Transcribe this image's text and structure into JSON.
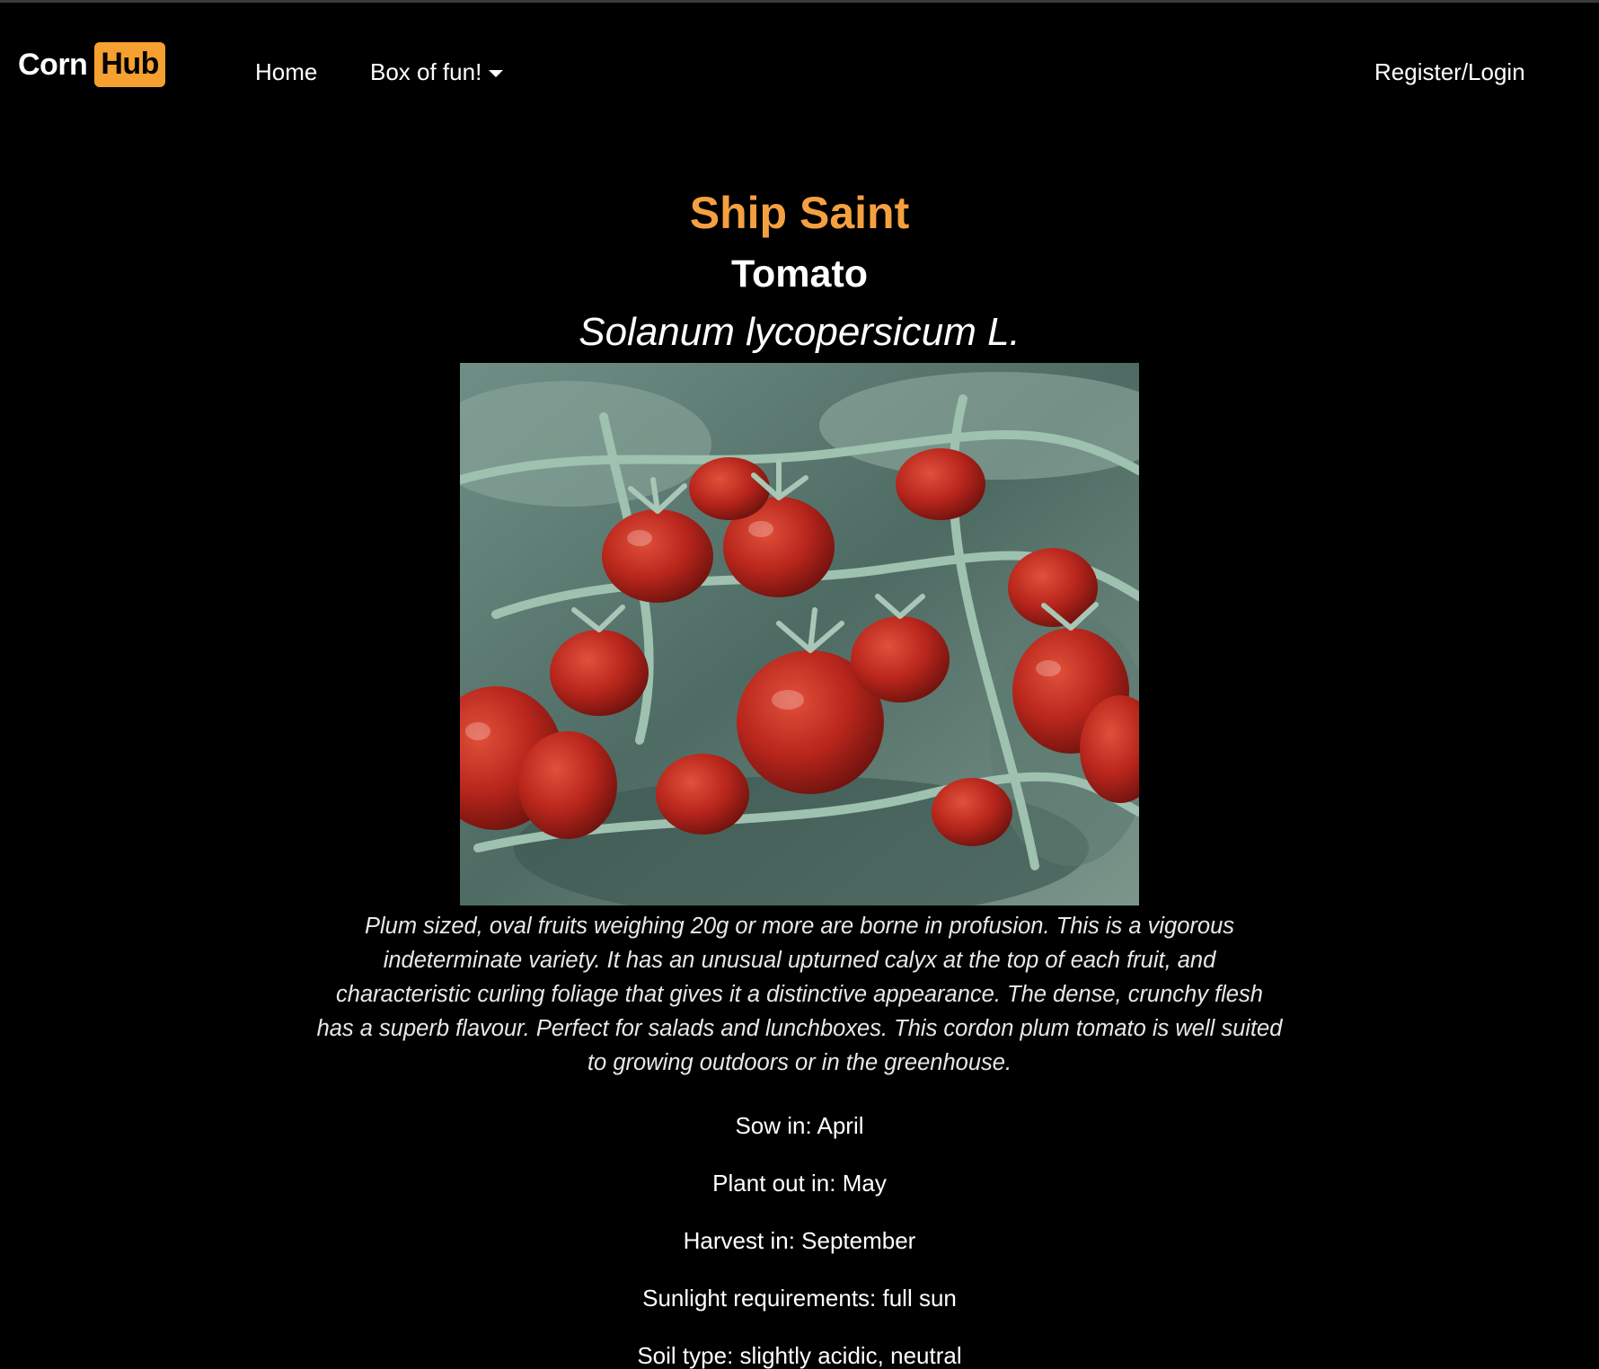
{
  "navbar": {
    "logo": {
      "part1": "Corn",
      "part2": "Hub"
    },
    "links": {
      "home": "Home",
      "box_of_fun": "Box of fun!",
      "register_login": "Register/Login"
    }
  },
  "colors": {
    "accent": "#f5a040",
    "background": "#000000",
    "text": "#ffffff"
  },
  "plant": {
    "variety": "Ship Saint",
    "crop": "Tomato",
    "latin_name": "Solanum lycopersicum L.",
    "image_subject": "clusters of red plum tomatoes on the vine",
    "description": "Plum sized, oval fruits weighing 20g or more are borne in profusion. This is a vigorous indeterminate variety. It has an unusual upturned calyx at the top of each fruit, and characteristic curling foliage that gives it a distinctive appearance. The dense, crunchy flesh has a superb flavour. Perfect for salads and lunchboxes. This cordon plum tomato is well suited to growing outdoors or in the greenhouse.",
    "facts": {
      "sow": "Sow in: April",
      "plant_out": "Plant out in: May",
      "harvest": "Harvest in: September",
      "sunlight": "Sunlight requirements: full sun",
      "soil": "Soil type: slightly acidic, neutral"
    }
  }
}
